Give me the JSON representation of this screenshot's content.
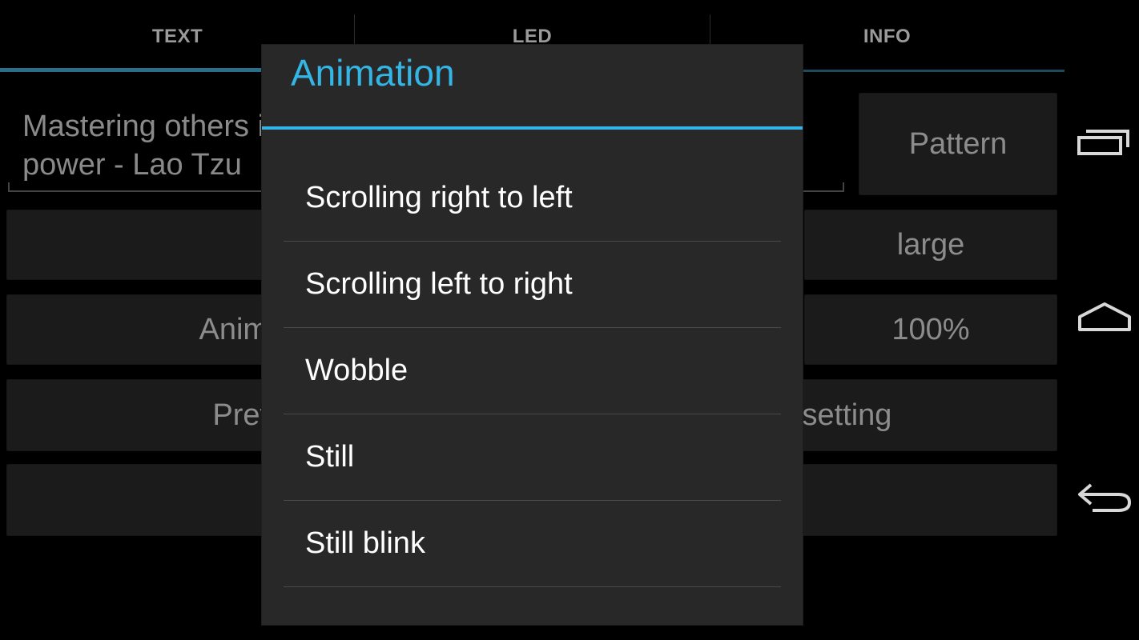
{
  "tabs": [
    {
      "label": "TEXT",
      "selected": true
    },
    {
      "label": "LED",
      "selected": false
    },
    {
      "label": "INFO",
      "selected": false
    }
  ],
  "text_input": {
    "value_line1": "Mastering others is strength. Mastering yourself is true",
    "value_line2": "power - Lao Tzu"
  },
  "buttons": {
    "pattern": "Pattern",
    "size": "large",
    "animation": "Animation",
    "speed": "100%",
    "preview": "Preview",
    "setting": "Overall setting",
    "bottom": ""
  },
  "dialog": {
    "title": "Animation",
    "items": [
      "Scrolling right to left",
      "Scrolling left to right",
      "Wobble",
      "Still",
      "Still blink"
    ]
  },
  "navbar": {
    "icons": [
      "recent-apps-icon",
      "home-icon",
      "back-icon"
    ]
  },
  "colors": {
    "accent": "#33b5e5",
    "background": "#000000",
    "dialog_bg": "#282828",
    "button_bg": "#1b1b1b"
  }
}
